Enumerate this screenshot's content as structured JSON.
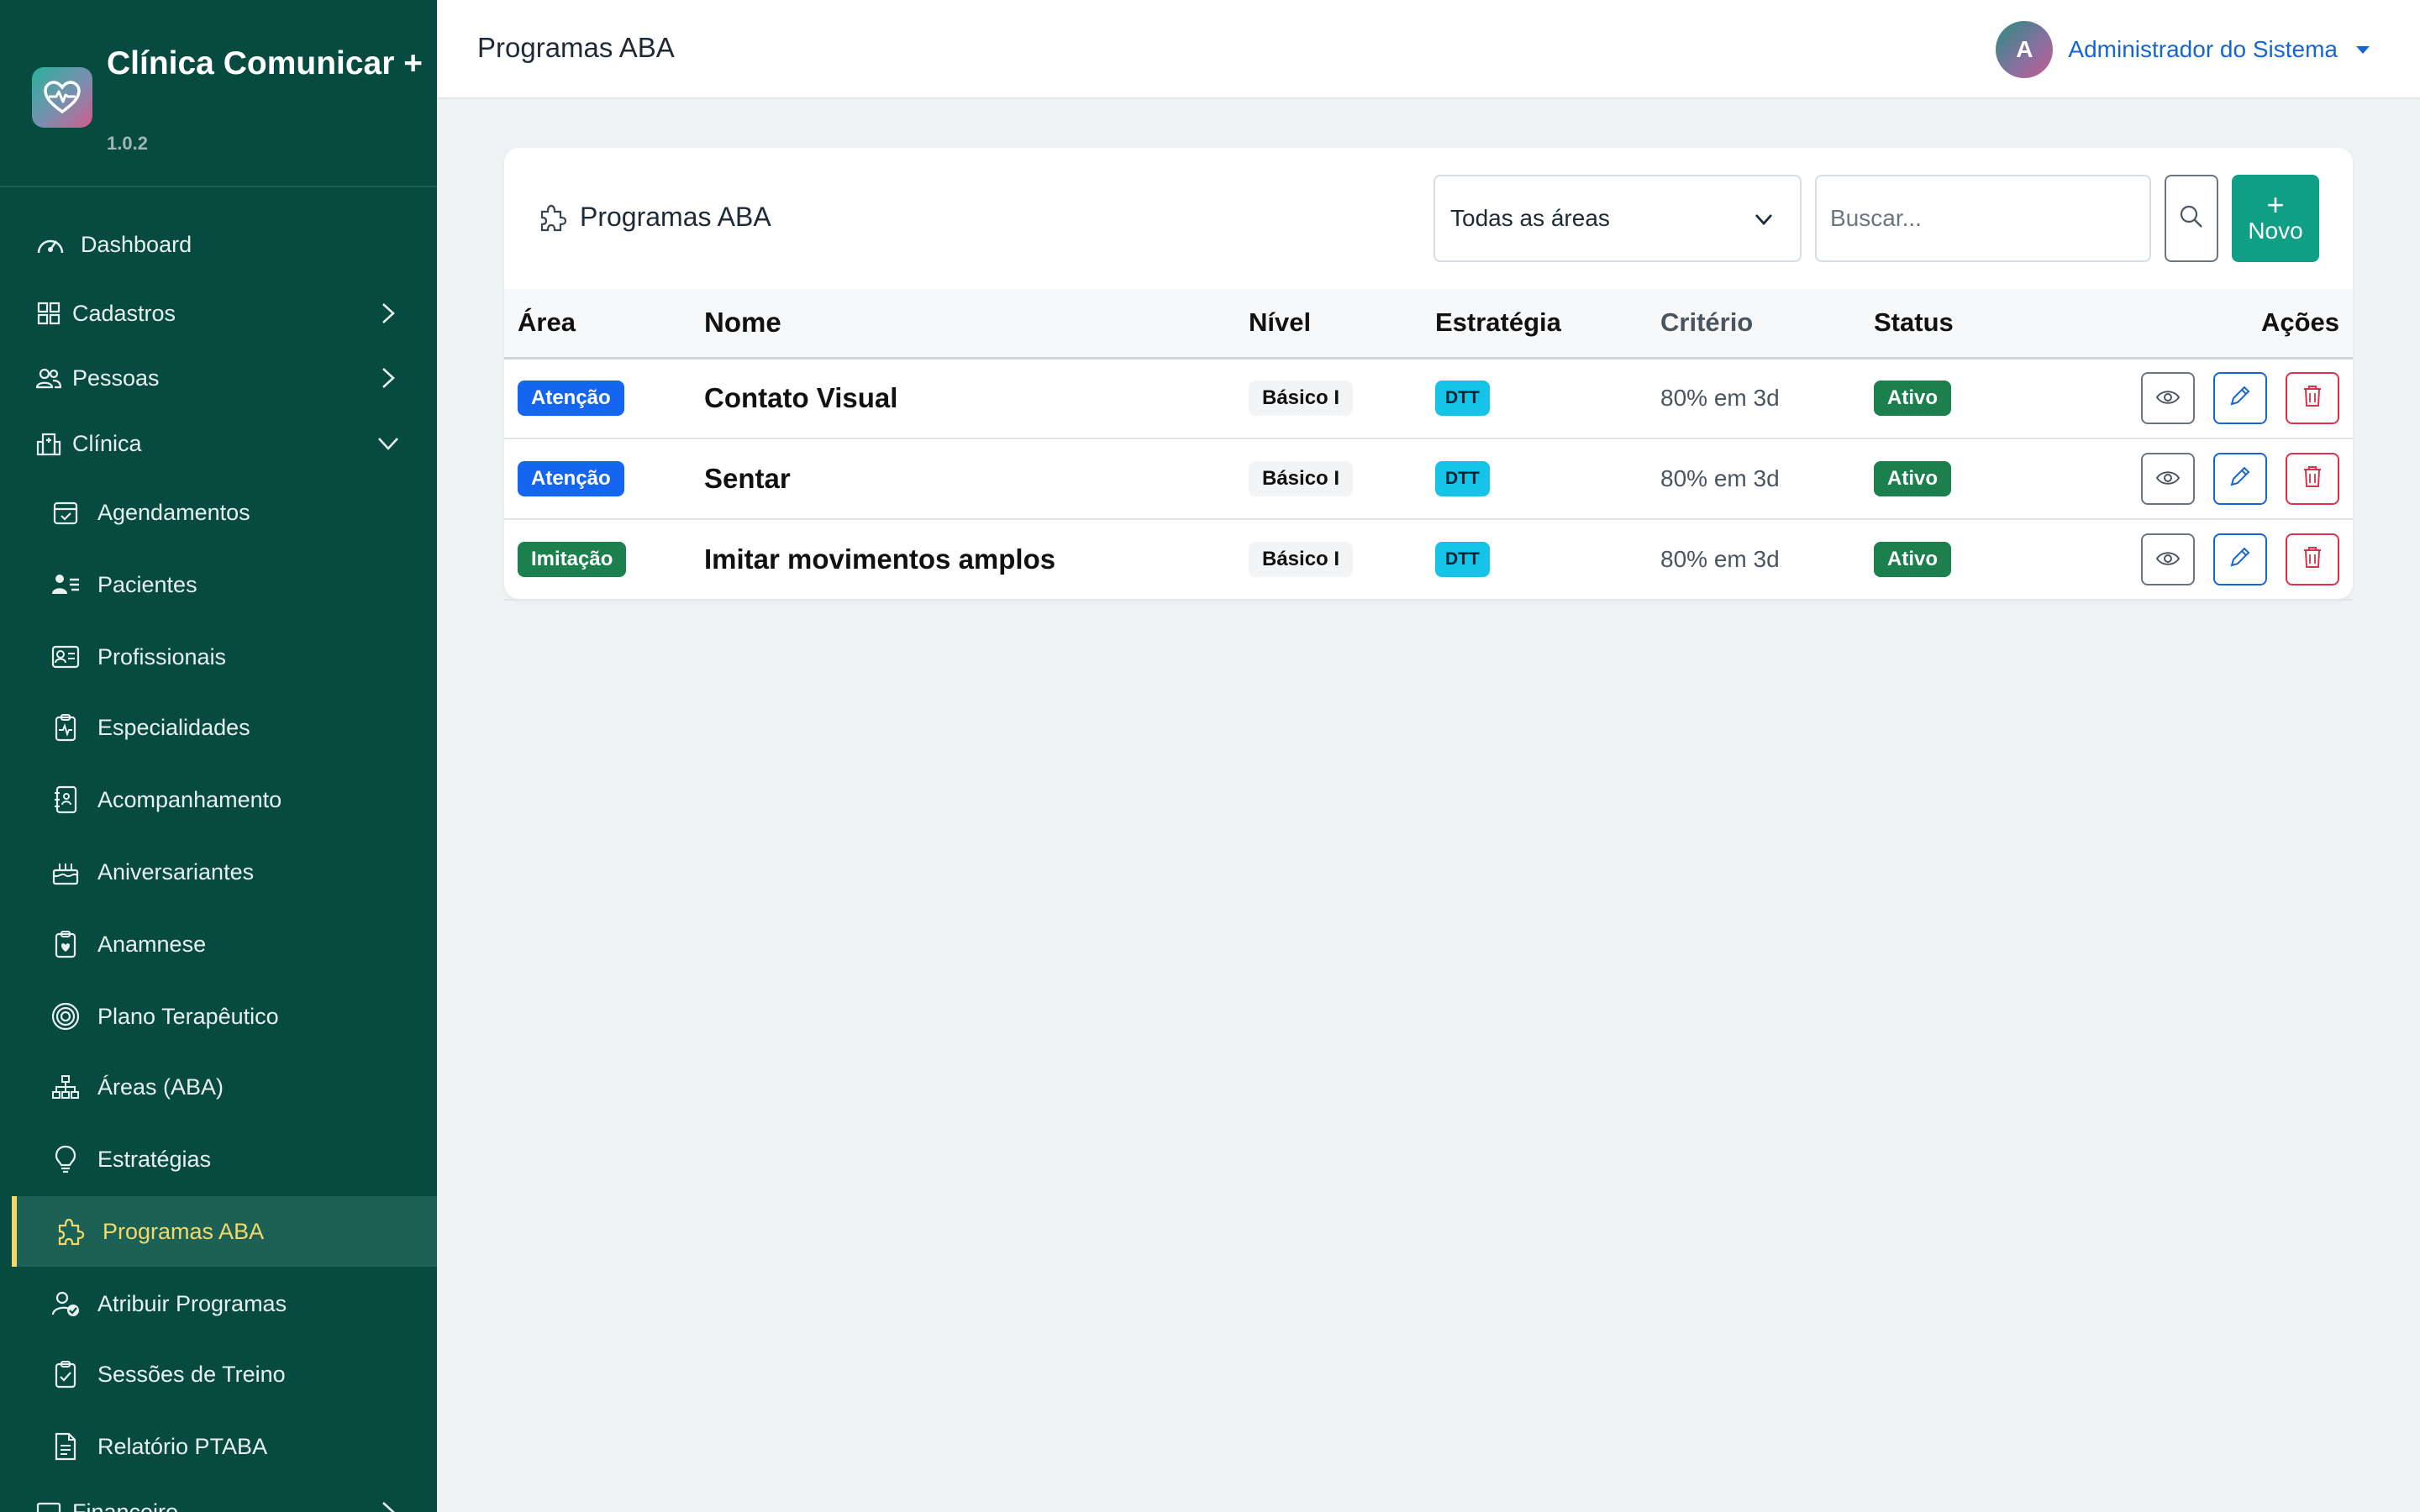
{
  "brand": {
    "title": "Clínica Comunicar +",
    "version": "1.0.2"
  },
  "sidebar": {
    "top_items": [
      {
        "label": "Dashboard",
        "icon": "speedometer-icon"
      },
      {
        "label": "Cadastros",
        "icon": "grid-icon"
      },
      {
        "label": "Pessoas",
        "icon": "people-icon"
      },
      {
        "label": "Clínica",
        "icon": "hospital-icon"
      }
    ],
    "clinica_items": [
      {
        "label": "Agendamentos",
        "icon": "calendar-icon"
      },
      {
        "label": "Pacientes",
        "icon": "person-lines-icon"
      },
      {
        "label": "Profissionais",
        "icon": "id-card-icon"
      },
      {
        "label": "Especialidades",
        "icon": "clipboard-pulse-icon"
      },
      {
        "label": "Acompanhamento",
        "icon": "journal-icon"
      },
      {
        "label": "Aniversariantes",
        "icon": "cake-icon"
      },
      {
        "label": "Anamnese",
        "icon": "clipboard-heart-icon"
      },
      {
        "label": "Plano Terapêutico",
        "icon": "target-icon"
      },
      {
        "label": "Áreas (ABA)",
        "icon": "diagram-icon"
      },
      {
        "label": "Estratégias",
        "icon": "lightbulb-icon"
      },
      {
        "label": "Programas ABA",
        "icon": "puzzle-icon"
      },
      {
        "label": "Atribuir Programas",
        "icon": "person-check-icon"
      },
      {
        "label": "Sessões de Treino",
        "icon": "clipboard-check-icon"
      },
      {
        "label": "Relatório PTABA",
        "icon": "file-text-icon"
      }
    ],
    "bottom_item": {
      "label": "Financeiro"
    },
    "active": "Programas ABA"
  },
  "header": {
    "page_title": "Programas ABA",
    "user_initial": "A",
    "user_name": "Administrador do Sistema"
  },
  "card": {
    "title": "Programas ABA",
    "area_filter": "Todas as áreas",
    "search_placeholder": "Buscar...",
    "new_button_plus": "+",
    "new_button": "Novo"
  },
  "table": {
    "columns": [
      "Área",
      "Nome",
      "Nível",
      "Estratégia",
      "Critério",
      "Status",
      "Ações"
    ],
    "rows": [
      {
        "area": "Atenção",
        "nome": "Contato Visual",
        "nivel": "Básico I",
        "estrategia": "DTT",
        "criterio": "80% em 3d",
        "status": "Ativo"
      },
      {
        "area": "Atenção",
        "nome": "Sentar",
        "nivel": "Básico I",
        "estrategia": "DTT",
        "criterio": "80% em 3d",
        "status": "Ativo"
      },
      {
        "area": "Imitação",
        "nome": "Imitar movimentos amplos",
        "nivel": "Básico I",
        "estrategia": "DTT",
        "criterio": "80% em 3d",
        "status": "Ativo"
      }
    ]
  },
  "colors": {
    "sidebar_bg": "#064a40",
    "active_accent": "#f5d86a",
    "primary_button": "#0f9e86",
    "badge_attention": "#1466f0",
    "badge_imitation": "#1b7f4e",
    "badge_dtt": "#14c3e6",
    "link_blue": "#1466d6",
    "danger": "#d9334a"
  }
}
